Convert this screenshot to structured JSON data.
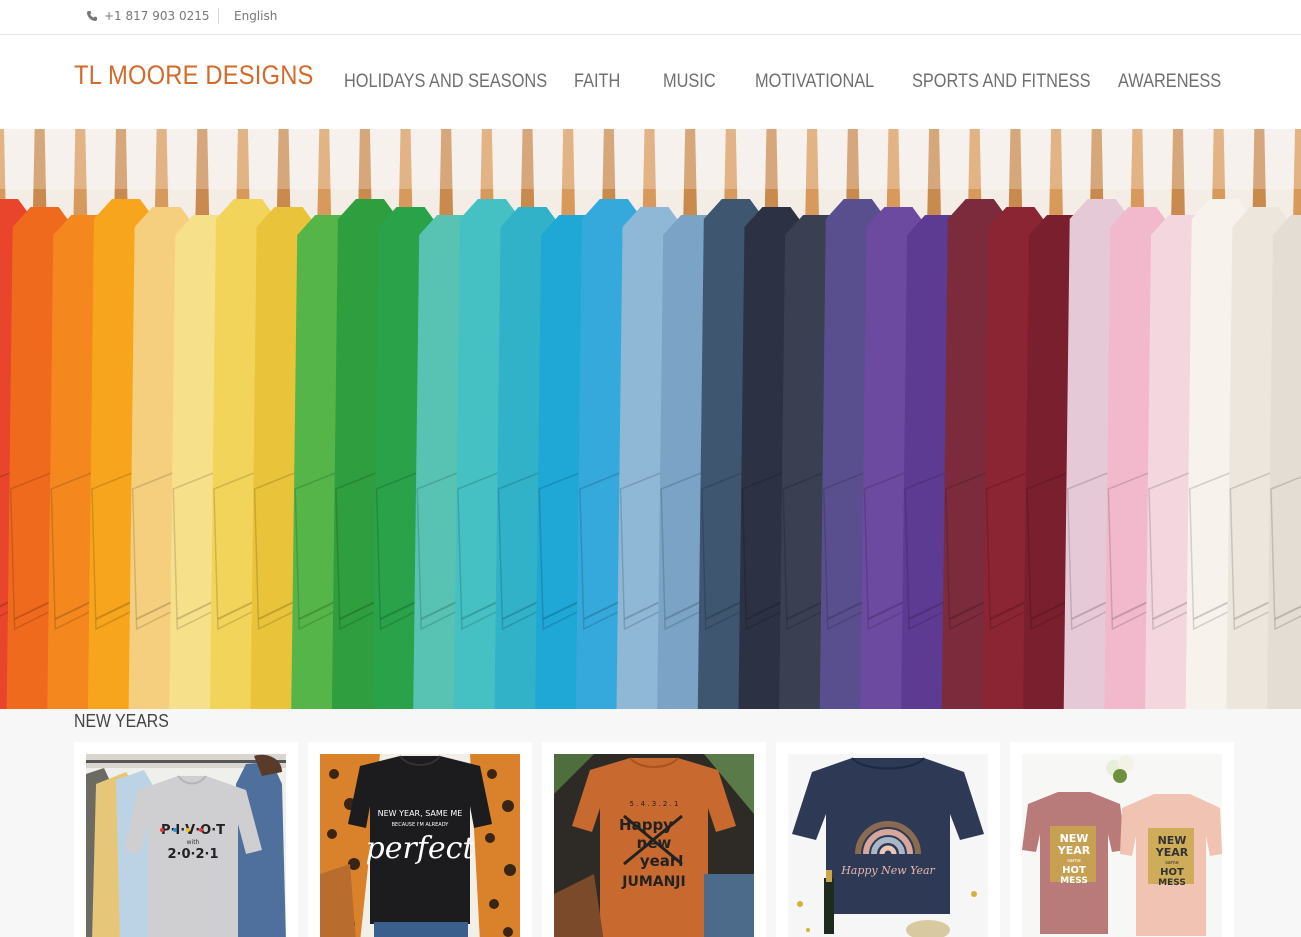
{
  "topbar": {
    "phone": "+1 817 903 0215",
    "language": "English",
    "phone_icon": "phone-icon"
  },
  "header": {
    "logo": "TL MOORE DESIGNS"
  },
  "nav": [
    {
      "label": "HOLIDAYS AND SEASONS"
    },
    {
      "label": "FAITH"
    },
    {
      "label": "MUSIC"
    },
    {
      "label": "MOTIVATIONAL"
    },
    {
      "label": "SPORTS AND FITNESS"
    },
    {
      "label": "AWARENESS"
    }
  ],
  "section": {
    "title": "NEW YEARS"
  },
  "products": [
    {
      "shirt_text": [
        "P·I·V·O·T",
        "with",
        "2·0·2·1"
      ]
    },
    {
      "shirt_text": [
        "NEW YEAR, SAME ME",
        "BECAUSE I'M ALREADY",
        "perfect"
      ]
    },
    {
      "shirt_text": [
        "5 . 4 . 3 . 2 . 1",
        "Happy",
        "new",
        "year!",
        "JUMANJI"
      ]
    },
    {
      "shirt_text": [
        "Happy New Year"
      ]
    },
    {
      "shirt_text": [
        "NEW",
        "YEAR",
        "same",
        "HOT",
        "MESS"
      ]
    }
  ],
  "colors": {
    "accent": "#d46a2a",
    "nav_text": "#6f6f6f",
    "section_bg": "#f7f7f7"
  }
}
